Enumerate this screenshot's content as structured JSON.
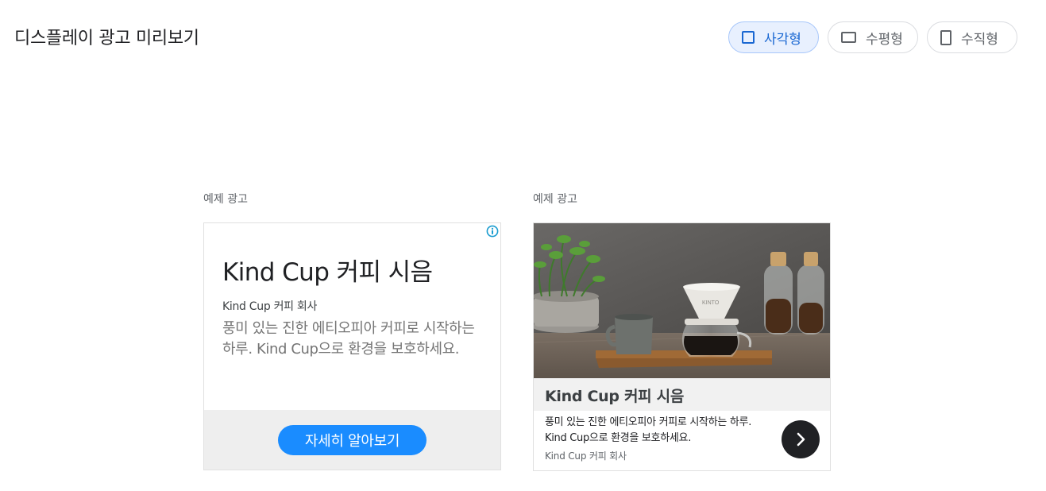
{
  "header": {
    "title": "디스플레이 광고 미리보기"
  },
  "format_switch": {
    "options": [
      {
        "label": "사각형",
        "icon": "square-icon",
        "selected": true
      },
      {
        "label": "수평형",
        "icon": "landscape-rectangle-icon",
        "selected": false
      },
      {
        "label": "수직형",
        "icon": "portrait-rectangle-icon",
        "selected": false
      }
    ]
  },
  "ads": [
    {
      "label": "예제 광고",
      "headline": "Kind Cup 커피 시음",
      "advertiser": "Kind Cup 커피 회사",
      "description": "풍미 있는 진한 에티오피아 커피로 시작하는 하루. Kind Cup으로 환경을 보호하세요.",
      "cta": "자세히 알아보기",
      "info_icon": "info-icon"
    },
    {
      "label": "예제 광고",
      "image": "coffee-pour-over-photo",
      "headline": "Kind Cup 커피 시음",
      "description": "풍미 있는 진한 에티오피아 커피로 시작하는 하루. Kind Cup으로 환경을 보호하세요.",
      "advertiser": "Kind Cup 커피 회사",
      "arrow_icon": "chevron-right-icon"
    }
  ],
  "colors": {
    "accent": "#1a8cff",
    "selected_bg": "#e8f0fe",
    "selected_text": "#1967d2",
    "info_icon": "#1a9ccf"
  }
}
